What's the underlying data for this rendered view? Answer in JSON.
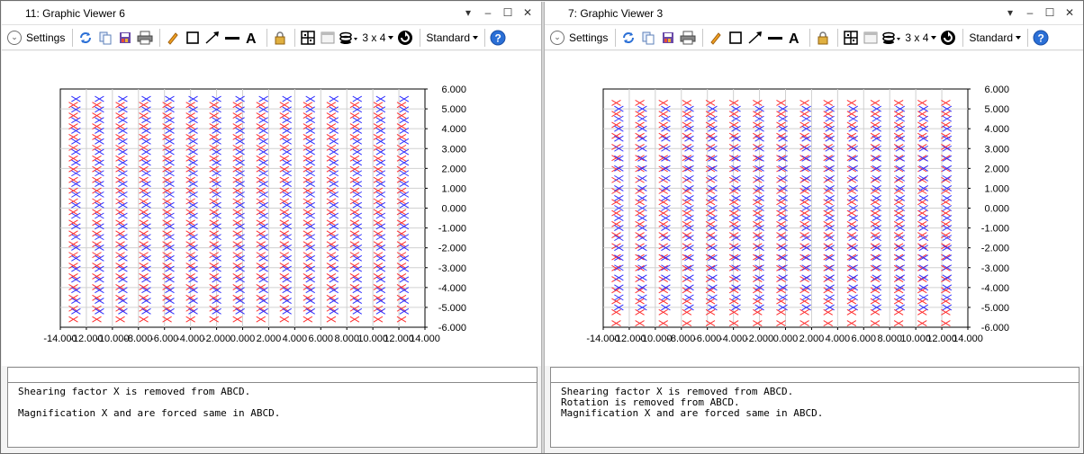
{
  "panes": [
    {
      "title": "11: Graphic Viewer 6",
      "toolbar": {
        "settings_label": "Settings",
        "layout_label": "3 x 4",
        "style_label": "Standard"
      },
      "console_lines": [
        "Shearing factor X is removed from ABCD.",
        "",
        "Magnification X and are forced same in ABCD."
      ]
    },
    {
      "title": "7: Graphic Viewer 3",
      "toolbar": {
        "settings_label": "Settings",
        "layout_label": "3 x 4",
        "style_label": "Standard"
      },
      "console_lines": [
        "Shearing factor X is removed from ABCD.",
        "Rotation is removed from ABCD.",
        "Magnification X and are forced same in ABCD."
      ]
    }
  ],
  "window_controls": {
    "menu": "▾",
    "minimize": "–",
    "maximize": "☐",
    "close": "✕"
  },
  "icons": [
    "settings-circle-icon",
    "refresh-icon",
    "copy-icon",
    "save-icon",
    "print-icon",
    "pencil-icon",
    "rectangle-icon",
    "arrow-icon",
    "line-icon",
    "text-icon",
    "lock-icon",
    "grid-icon",
    "window-icon",
    "layers-icon",
    "rotate-icon",
    "help-icon"
  ],
  "colors": {
    "series_a": "#ff3030",
    "series_b": "#3030ff",
    "help": "#2a6fd6"
  },
  "chart_data": [
    {
      "type": "scatter",
      "title": "",
      "xlabel": "",
      "ylabel": "",
      "xlim": [
        -14,
        14
      ],
      "ylim": [
        -6,
        6
      ],
      "x_ticks": [
        "-14.000",
        "-12.000",
        "-10.000",
        "-8.000",
        "-6.000",
        "-4.000",
        "-2.000",
        "0.000",
        "2.000",
        "4.000",
        "6.000",
        "8.000",
        "10.000",
        "12.000",
        "14.000"
      ],
      "y_ticks": [
        "6.000",
        "5.000",
        "4.000",
        "3.000",
        "2.000",
        "1.000",
        "0.000",
        "-1.000",
        "-2.000",
        "-3.000",
        "-4.000",
        "-5.000",
        "-6.000"
      ],
      "grid": true,
      "marker": "x",
      "series": [
        {
          "color": "#ff3030",
          "grid_cols": 15,
          "grid_rows": 21,
          "x_range": [
            -13.0,
            12.2
          ],
          "y_range": [
            -5.6,
            5.2
          ]
        },
        {
          "color": "#3030ff",
          "grid_cols": 15,
          "grid_rows": 21,
          "x_range": [
            -12.8,
            12.4
          ],
          "y_range": [
            -5.2,
            5.5
          ]
        }
      ]
    },
    {
      "type": "scatter",
      "title": "",
      "xlabel": "",
      "ylabel": "",
      "xlim": [
        -14,
        14
      ],
      "ylim": [
        -6,
        6
      ],
      "x_ticks": [
        "-14.000",
        "-12.000",
        "-10.000",
        "-8.000",
        "-6.000",
        "-4.000",
        "-2.000",
        "0.000",
        "2.000",
        "4.000",
        "6.000",
        "8.000",
        "10.000",
        "12.000",
        "14.000"
      ],
      "y_ticks": [
        "6.000",
        "5.000",
        "4.000",
        "3.000",
        "2.000",
        "1.000",
        "0.000",
        "-1.000",
        "-2.000",
        "-3.000",
        "-4.000",
        "-5.000",
        "-6.000"
      ],
      "grid": true,
      "marker": "x",
      "series": [
        {
          "color": "#ff3030",
          "grid_cols": 15,
          "grid_rows": 21,
          "x_range": [
            -13.0,
            12.3
          ],
          "y_range": [
            -5.8,
            5.3
          ]
        },
        {
          "color": "#3030ff",
          "grid_cols": 15,
          "grid_rows": 21,
          "x_range": [
            -12.8,
            12.4
          ],
          "y_range": [
            -5.0,
            5.0
          ]
        }
      ]
    }
  ]
}
